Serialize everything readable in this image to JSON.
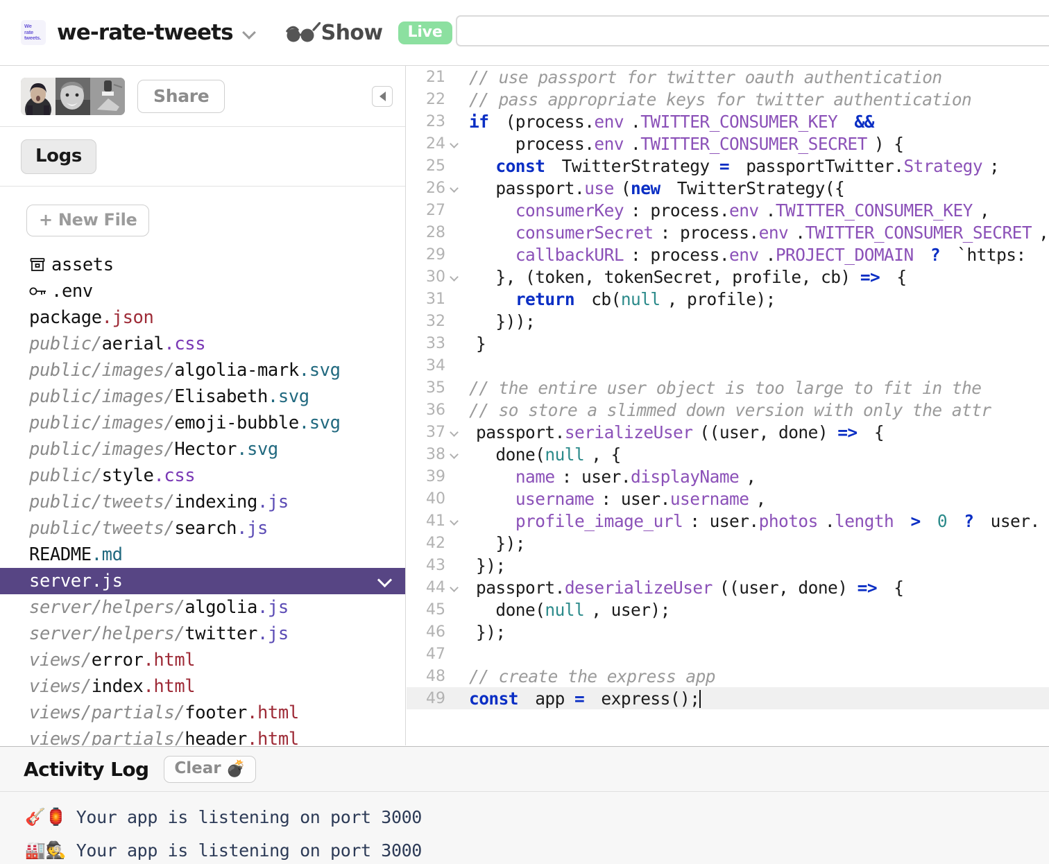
{
  "topbar": {
    "logo_lines": [
      "We",
      "rate",
      "tweets."
    ],
    "project_name": "we-rate-tweets",
    "project_dropdown_icon": "chevron-down-icon",
    "show_icon": "sunglasses-icon",
    "show_label": "Show",
    "live_badge": "Live",
    "live_badge_color": "#8ce0a0",
    "url_value": "",
    "url_placeholder": ""
  },
  "sidebar": {
    "share_label": "Share",
    "collapse_icon": "collapse-left-icon",
    "logs_label": "Logs",
    "new_file_label": "+ New File",
    "selected_file": "server.js",
    "files": [
      {
        "icon": "archive-icon",
        "dir": "",
        "base": "assets",
        "ext": ""
      },
      {
        "icon": "key-icon",
        "dir": "",
        "base": ".env",
        "ext": ""
      },
      {
        "icon": "",
        "dir": "",
        "base": "package",
        "ext": ".json"
      },
      {
        "icon": "",
        "dir": "public/",
        "base": "aerial",
        "ext": ".css"
      },
      {
        "icon": "",
        "dir": "public/images/",
        "base": "algolia-mark",
        "ext": ".svg"
      },
      {
        "icon": "",
        "dir": "public/images/",
        "base": "Elisabeth",
        "ext": ".svg"
      },
      {
        "icon": "",
        "dir": "public/images/",
        "base": "emoji-bubble",
        "ext": ".svg"
      },
      {
        "icon": "",
        "dir": "public/images/",
        "base": "Hector",
        "ext": ".svg"
      },
      {
        "icon": "",
        "dir": "public/",
        "base": "style",
        "ext": ".css"
      },
      {
        "icon": "",
        "dir": "public/tweets/",
        "base": "indexing",
        "ext": ".js"
      },
      {
        "icon": "",
        "dir": "public/tweets/",
        "base": "search",
        "ext": ".js"
      },
      {
        "icon": "",
        "dir": "",
        "base": "README",
        "ext": ".md"
      },
      {
        "icon": "",
        "dir": "",
        "base": "server",
        "ext": ".js",
        "selected": true
      },
      {
        "icon": "",
        "dir": "server/helpers/",
        "base": "algolia",
        "ext": ".js"
      },
      {
        "icon": "",
        "dir": "server/helpers/",
        "base": "twitter",
        "ext": ".js"
      },
      {
        "icon": "",
        "dir": "views/",
        "base": "error",
        "ext": ".html"
      },
      {
        "icon": "",
        "dir": "views/",
        "base": "index",
        "ext": ".html"
      },
      {
        "icon": "",
        "dir": "views/partials/",
        "base": "footer",
        "ext": ".html"
      },
      {
        "icon": "",
        "dir": "views/partials/",
        "base": "header",
        "ext": ".html"
      }
    ]
  },
  "editor": {
    "file": "server.js",
    "active_line": 49,
    "lines": [
      {
        "n": 21,
        "fold": false,
        "tokens": [
          {
            "t": "cmt",
            "v": "// use passport for twitter oauth authentication"
          }
        ]
      },
      {
        "n": 22,
        "fold": false,
        "tokens": [
          {
            "t": "cmt",
            "v": "// pass appropriate keys for twitter authentication"
          }
        ]
      },
      {
        "n": 23,
        "fold": false,
        "tokens": [
          {
            "t": "kw",
            "v": "if"
          },
          {
            "t": "src",
            "v": " (process."
          },
          {
            "t": "prp",
            "v": "env"
          },
          {
            "t": "src",
            "v": "."
          },
          {
            "t": "prp",
            "v": "TWITTER_CONSUMER_KEY"
          },
          {
            "t": "src",
            "v": " "
          },
          {
            "t": "op",
            "v": "&&"
          }
        ]
      },
      {
        "n": 24,
        "fold": true,
        "tokens": [
          {
            "t": "src",
            "v": "    process."
          },
          {
            "t": "prp",
            "v": "env"
          },
          {
            "t": "src",
            "v": "."
          },
          {
            "t": "prp",
            "v": "TWITTER_CONSUMER_SECRET"
          },
          {
            "t": "src",
            "v": ") {"
          }
        ]
      },
      {
        "n": 25,
        "fold": false,
        "tokens": [
          {
            "t": "src",
            "v": "  "
          },
          {
            "t": "kw",
            "v": "const"
          },
          {
            "t": "src",
            "v": " TwitterStrategy "
          },
          {
            "t": "op",
            "v": "="
          },
          {
            "t": "src",
            "v": " passportTwitter."
          },
          {
            "t": "prp",
            "v": "Strategy"
          },
          {
            "t": "src",
            "v": ";"
          }
        ]
      },
      {
        "n": 26,
        "fold": true,
        "tokens": [
          {
            "t": "src",
            "v": "  passport."
          },
          {
            "t": "prp",
            "v": "use"
          },
          {
            "t": "src",
            "v": "("
          },
          {
            "t": "kw",
            "v": "new"
          },
          {
            "t": "src",
            "v": " TwitterStrategy({"
          }
        ]
      },
      {
        "n": 27,
        "fold": false,
        "tokens": [
          {
            "t": "src",
            "v": "    "
          },
          {
            "t": "prp",
            "v": "consumerKey"
          },
          {
            "t": "src",
            "v": ": process."
          },
          {
            "t": "prp",
            "v": "env"
          },
          {
            "t": "src",
            "v": "."
          },
          {
            "t": "prp",
            "v": "TWITTER_CONSUMER_KEY"
          },
          {
            "t": "src",
            "v": ","
          }
        ]
      },
      {
        "n": 28,
        "fold": false,
        "tokens": [
          {
            "t": "src",
            "v": "    "
          },
          {
            "t": "prp",
            "v": "consumerSecret"
          },
          {
            "t": "src",
            "v": ": process."
          },
          {
            "t": "prp",
            "v": "env"
          },
          {
            "t": "src",
            "v": "."
          },
          {
            "t": "prp",
            "v": "TWITTER_CONSUMER_SECRET"
          },
          {
            "t": "src",
            "v": ","
          }
        ]
      },
      {
        "n": 29,
        "fold": false,
        "tokens": [
          {
            "t": "src",
            "v": "    "
          },
          {
            "t": "prp",
            "v": "callbackURL"
          },
          {
            "t": "src",
            "v": ": process."
          },
          {
            "t": "prp",
            "v": "env"
          },
          {
            "t": "src",
            "v": "."
          },
          {
            "t": "prp",
            "v": "PROJECT_DOMAIN"
          },
          {
            "t": "src",
            "v": " "
          },
          {
            "t": "op",
            "v": "?"
          },
          {
            "t": "src",
            "v": " `https:"
          }
        ]
      },
      {
        "n": 30,
        "fold": true,
        "tokens": [
          {
            "t": "src",
            "v": "  }, (token, tokenSecret, profile, cb) "
          },
          {
            "t": "op",
            "v": "=>"
          },
          {
            "t": "src",
            "v": " {"
          }
        ]
      },
      {
        "n": 31,
        "fold": false,
        "tokens": [
          {
            "t": "src",
            "v": "    "
          },
          {
            "t": "kw",
            "v": "return"
          },
          {
            "t": "src",
            "v": " cb("
          },
          {
            "t": "num",
            "v": "null"
          },
          {
            "t": "src",
            "v": ", profile);"
          }
        ]
      },
      {
        "n": 32,
        "fold": false,
        "tokens": [
          {
            "t": "src",
            "v": "  }));"
          }
        ]
      },
      {
        "n": 33,
        "fold": false,
        "tokens": [
          {
            "t": "src",
            "v": "}"
          }
        ]
      },
      {
        "n": 34,
        "fold": false,
        "tokens": []
      },
      {
        "n": 35,
        "fold": false,
        "tokens": [
          {
            "t": "cmt",
            "v": "// the entire user object is too large to fit in the"
          }
        ]
      },
      {
        "n": 36,
        "fold": false,
        "tokens": [
          {
            "t": "cmt",
            "v": "// so store a slimmed down version with only the attr"
          }
        ]
      },
      {
        "n": 37,
        "fold": true,
        "tokens": [
          {
            "t": "src",
            "v": "passport."
          },
          {
            "t": "prp",
            "v": "serializeUser"
          },
          {
            "t": "src",
            "v": "((user, done) "
          },
          {
            "t": "op",
            "v": "=>"
          },
          {
            "t": "src",
            "v": " {"
          }
        ]
      },
      {
        "n": 38,
        "fold": true,
        "tokens": [
          {
            "t": "src",
            "v": "  done("
          },
          {
            "t": "num",
            "v": "null"
          },
          {
            "t": "src",
            "v": ", {"
          }
        ]
      },
      {
        "n": 39,
        "fold": false,
        "tokens": [
          {
            "t": "src",
            "v": "    "
          },
          {
            "t": "prp",
            "v": "name"
          },
          {
            "t": "src",
            "v": ": user."
          },
          {
            "t": "prp",
            "v": "displayName"
          },
          {
            "t": "src",
            "v": ","
          }
        ]
      },
      {
        "n": 40,
        "fold": false,
        "tokens": [
          {
            "t": "src",
            "v": "    "
          },
          {
            "t": "prp",
            "v": "username"
          },
          {
            "t": "src",
            "v": ": user."
          },
          {
            "t": "prp",
            "v": "username"
          },
          {
            "t": "src",
            "v": ","
          }
        ]
      },
      {
        "n": 41,
        "fold": true,
        "tokens": [
          {
            "t": "src",
            "v": "    "
          },
          {
            "t": "prp",
            "v": "profile_image_url"
          },
          {
            "t": "src",
            "v": ": user."
          },
          {
            "t": "prp",
            "v": "photos"
          },
          {
            "t": "src",
            "v": "."
          },
          {
            "t": "prp",
            "v": "length"
          },
          {
            "t": "src",
            "v": " "
          },
          {
            "t": "op",
            "v": ">"
          },
          {
            "t": "src",
            "v": " "
          },
          {
            "t": "num",
            "v": "0"
          },
          {
            "t": "src",
            "v": " "
          },
          {
            "t": "op",
            "v": "?"
          },
          {
            "t": "src",
            "v": " user."
          }
        ]
      },
      {
        "n": 42,
        "fold": false,
        "tokens": [
          {
            "t": "src",
            "v": "  });"
          }
        ]
      },
      {
        "n": 43,
        "fold": false,
        "tokens": [
          {
            "t": "src",
            "v": "});"
          }
        ]
      },
      {
        "n": 44,
        "fold": true,
        "tokens": [
          {
            "t": "src",
            "v": "passport."
          },
          {
            "t": "prp",
            "v": "deserializeUser"
          },
          {
            "t": "src",
            "v": "((user, done) "
          },
          {
            "t": "op",
            "v": "=>"
          },
          {
            "t": "src",
            "v": " {"
          }
        ]
      },
      {
        "n": 45,
        "fold": false,
        "tokens": [
          {
            "t": "src",
            "v": "  done("
          },
          {
            "t": "num",
            "v": "null"
          },
          {
            "t": "src",
            "v": ", user);"
          }
        ]
      },
      {
        "n": 46,
        "fold": false,
        "tokens": [
          {
            "t": "src",
            "v": "});"
          }
        ]
      },
      {
        "n": 47,
        "fold": false,
        "tokens": []
      },
      {
        "n": 48,
        "fold": false,
        "tokens": [
          {
            "t": "cmt",
            "v": "// create the express app"
          }
        ]
      },
      {
        "n": 49,
        "fold": false,
        "active": true,
        "tokens": [
          {
            "t": "kw",
            "v": "const"
          },
          {
            "t": "src",
            "v": " app "
          },
          {
            "t": "op",
            "v": "="
          },
          {
            "t": "src",
            "v": " express();"
          },
          {
            "t": "caret",
            "v": ""
          }
        ]
      }
    ]
  },
  "activity_log": {
    "title": "Activity Log",
    "clear_label": "Clear",
    "clear_icon": "bomb-icon",
    "entries": [
      {
        "emoji": "🎸🏮",
        "text": "Your app is listening on port 3000"
      },
      {
        "emoji": "🏭🕵️",
        "text": "Your app is listening on port 3000"
      }
    ]
  }
}
